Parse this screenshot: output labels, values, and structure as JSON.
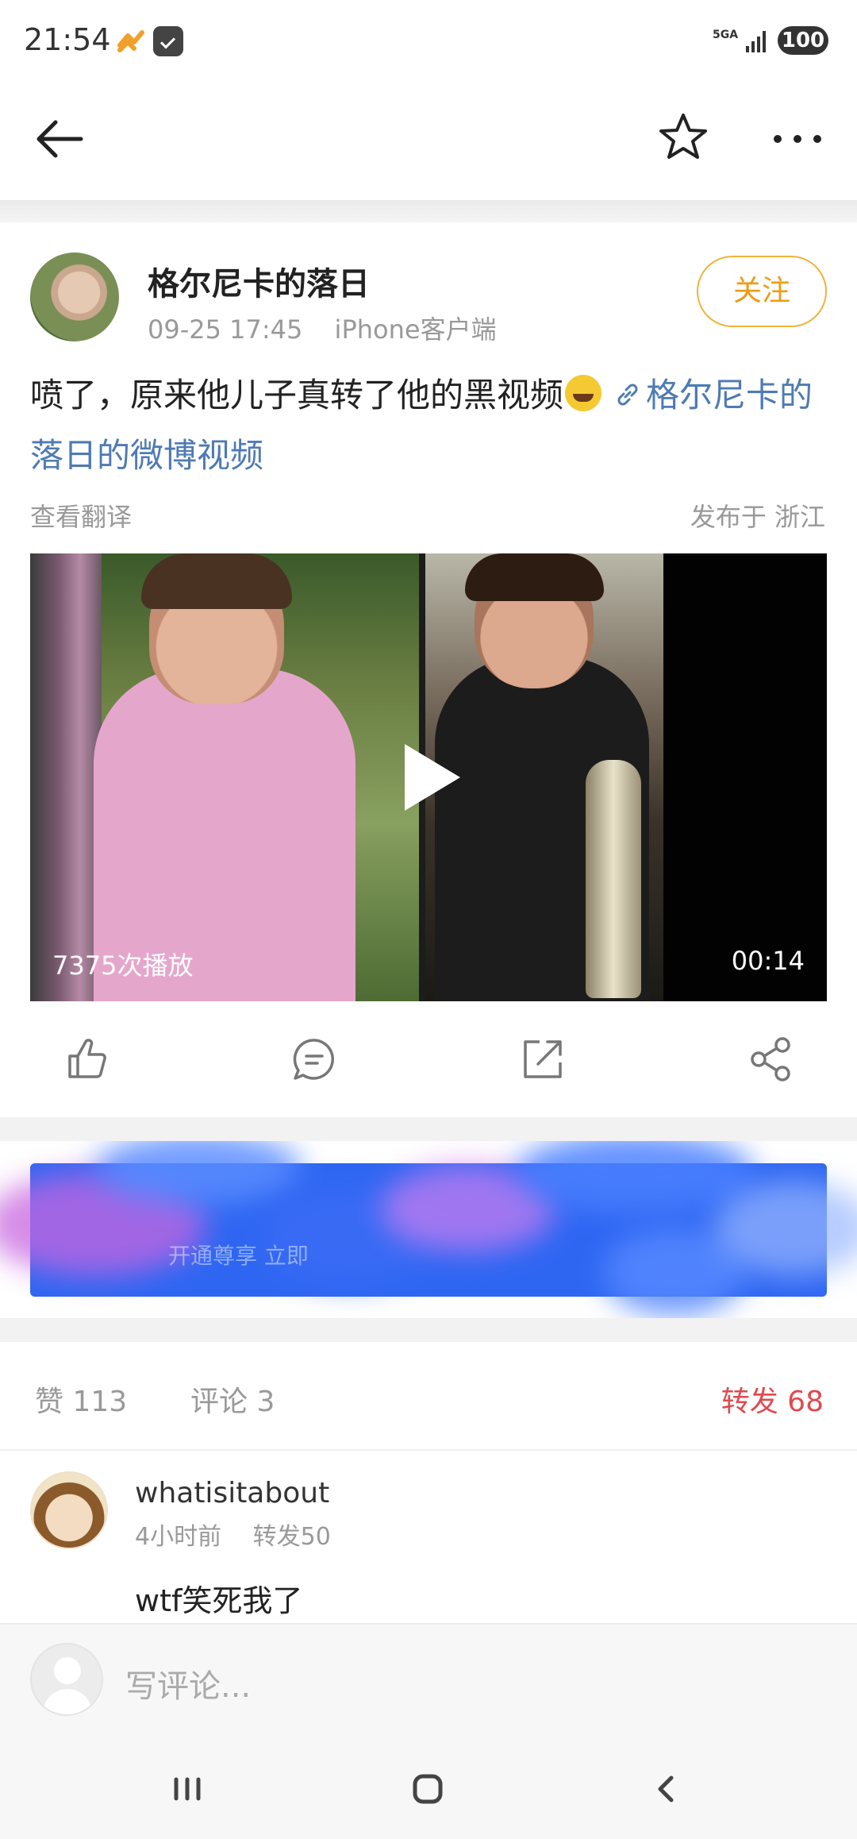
{
  "status_bar": {
    "time": "21:54",
    "network": "5GA",
    "battery": "100"
  },
  "nav": {
    "back": "back",
    "favorite": "star",
    "more": "more"
  },
  "post": {
    "author": "格尔尼卡的落日",
    "date": "09-25 17:45",
    "client": "iPhone客户端",
    "follow_label": "关注",
    "text": "喷了，原来他儿子真转了他的黑视频",
    "link_text": "格尔尼卡的落日的微博视频",
    "translate": "查看翻译",
    "location": "发布于 浙江"
  },
  "video": {
    "play_count": "7375次播放",
    "duration": "00:14"
  },
  "promo": {
    "text": "开通尊享 立即"
  },
  "stats": {
    "likes": "赞 113",
    "comments": "评论 3",
    "reposts": "转发 68"
  },
  "comment": {
    "user": "whatisitabout",
    "time": "4小时前",
    "reposts": "转发50",
    "text": "wtf笑死我了"
  },
  "write_comment": {
    "placeholder": "写评论..."
  },
  "colors": {
    "accent_orange": "#eb9c17",
    "link_blue": "#4e7bb3",
    "repost_red": "#e0494f",
    "promo_blue": "#2e66f2"
  },
  "icons": {
    "nav": [
      "back-arrow-icon",
      "star-icon",
      "more-icon"
    ],
    "actions": [
      "like-icon",
      "comment-icon",
      "forward-icon",
      "share-icon"
    ],
    "system": [
      "recent-apps-icon",
      "home-icon",
      "system-back-icon"
    ]
  }
}
